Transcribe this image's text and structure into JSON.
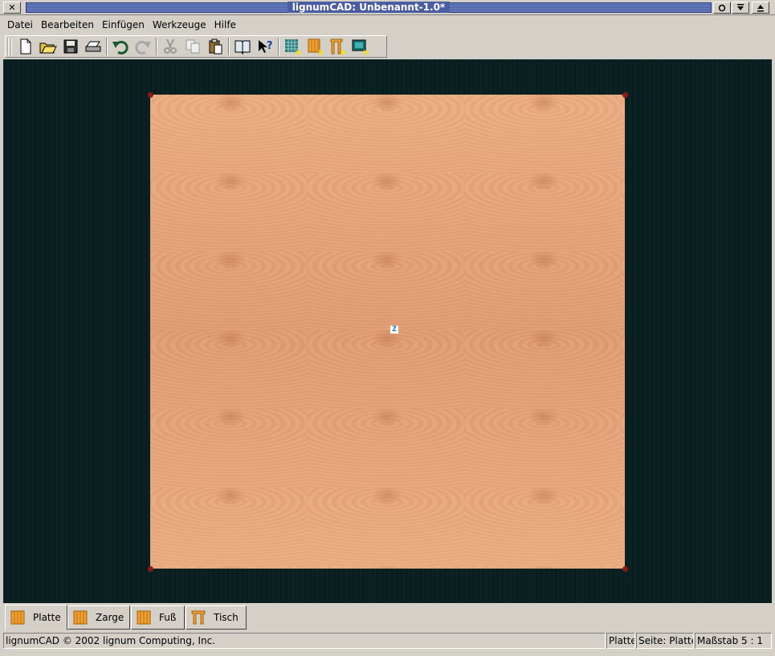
{
  "window": {
    "title": "lignumCAD: Unbenannt-1.0*",
    "close_glyph": "✕"
  },
  "menu": [
    {
      "label": "Datei",
      "name": "menu-datei"
    },
    {
      "label": "Bearbeiten",
      "name": "menu-bearbeiten"
    },
    {
      "label": "Einfügen",
      "name": "menu-einfuegen"
    },
    {
      "label": "Werkzeuge",
      "name": "menu-werkzeuge"
    },
    {
      "label": "Hilfe",
      "name": "menu-hilfe"
    }
  ],
  "toolbar_icons": [
    "new-file-icon",
    "open-folder-icon",
    "save-icon",
    "print-icon",
    "undo-icon",
    "redo-icon",
    "cut-icon",
    "copy-icon",
    "paste-icon",
    "manual-icon",
    "whats-this-icon",
    "new-grid-icon",
    "new-board-icon",
    "new-leg-icon",
    "new-assembly-icon"
  ],
  "canvas": {
    "board_label": "Z",
    "colors": {
      "background": "#081e20",
      "wood": "#e6a47c",
      "corner": "#8a1a14"
    }
  },
  "tabs": [
    {
      "label": "Platte",
      "name": "tab-platte",
      "active": true
    },
    {
      "label": "Zarge",
      "name": "tab-zarge",
      "active": false
    },
    {
      "label": "Fuß",
      "name": "tab-fuss",
      "active": false
    },
    {
      "label": "Tisch",
      "name": "tab-tisch",
      "active": false
    }
  ],
  "status": {
    "message": "lignumCAD © 2002 lignum Computing, Inc.",
    "page_type": "Platte",
    "page": "Seite: Platte",
    "scale": "Maßstab 5 : 1"
  }
}
